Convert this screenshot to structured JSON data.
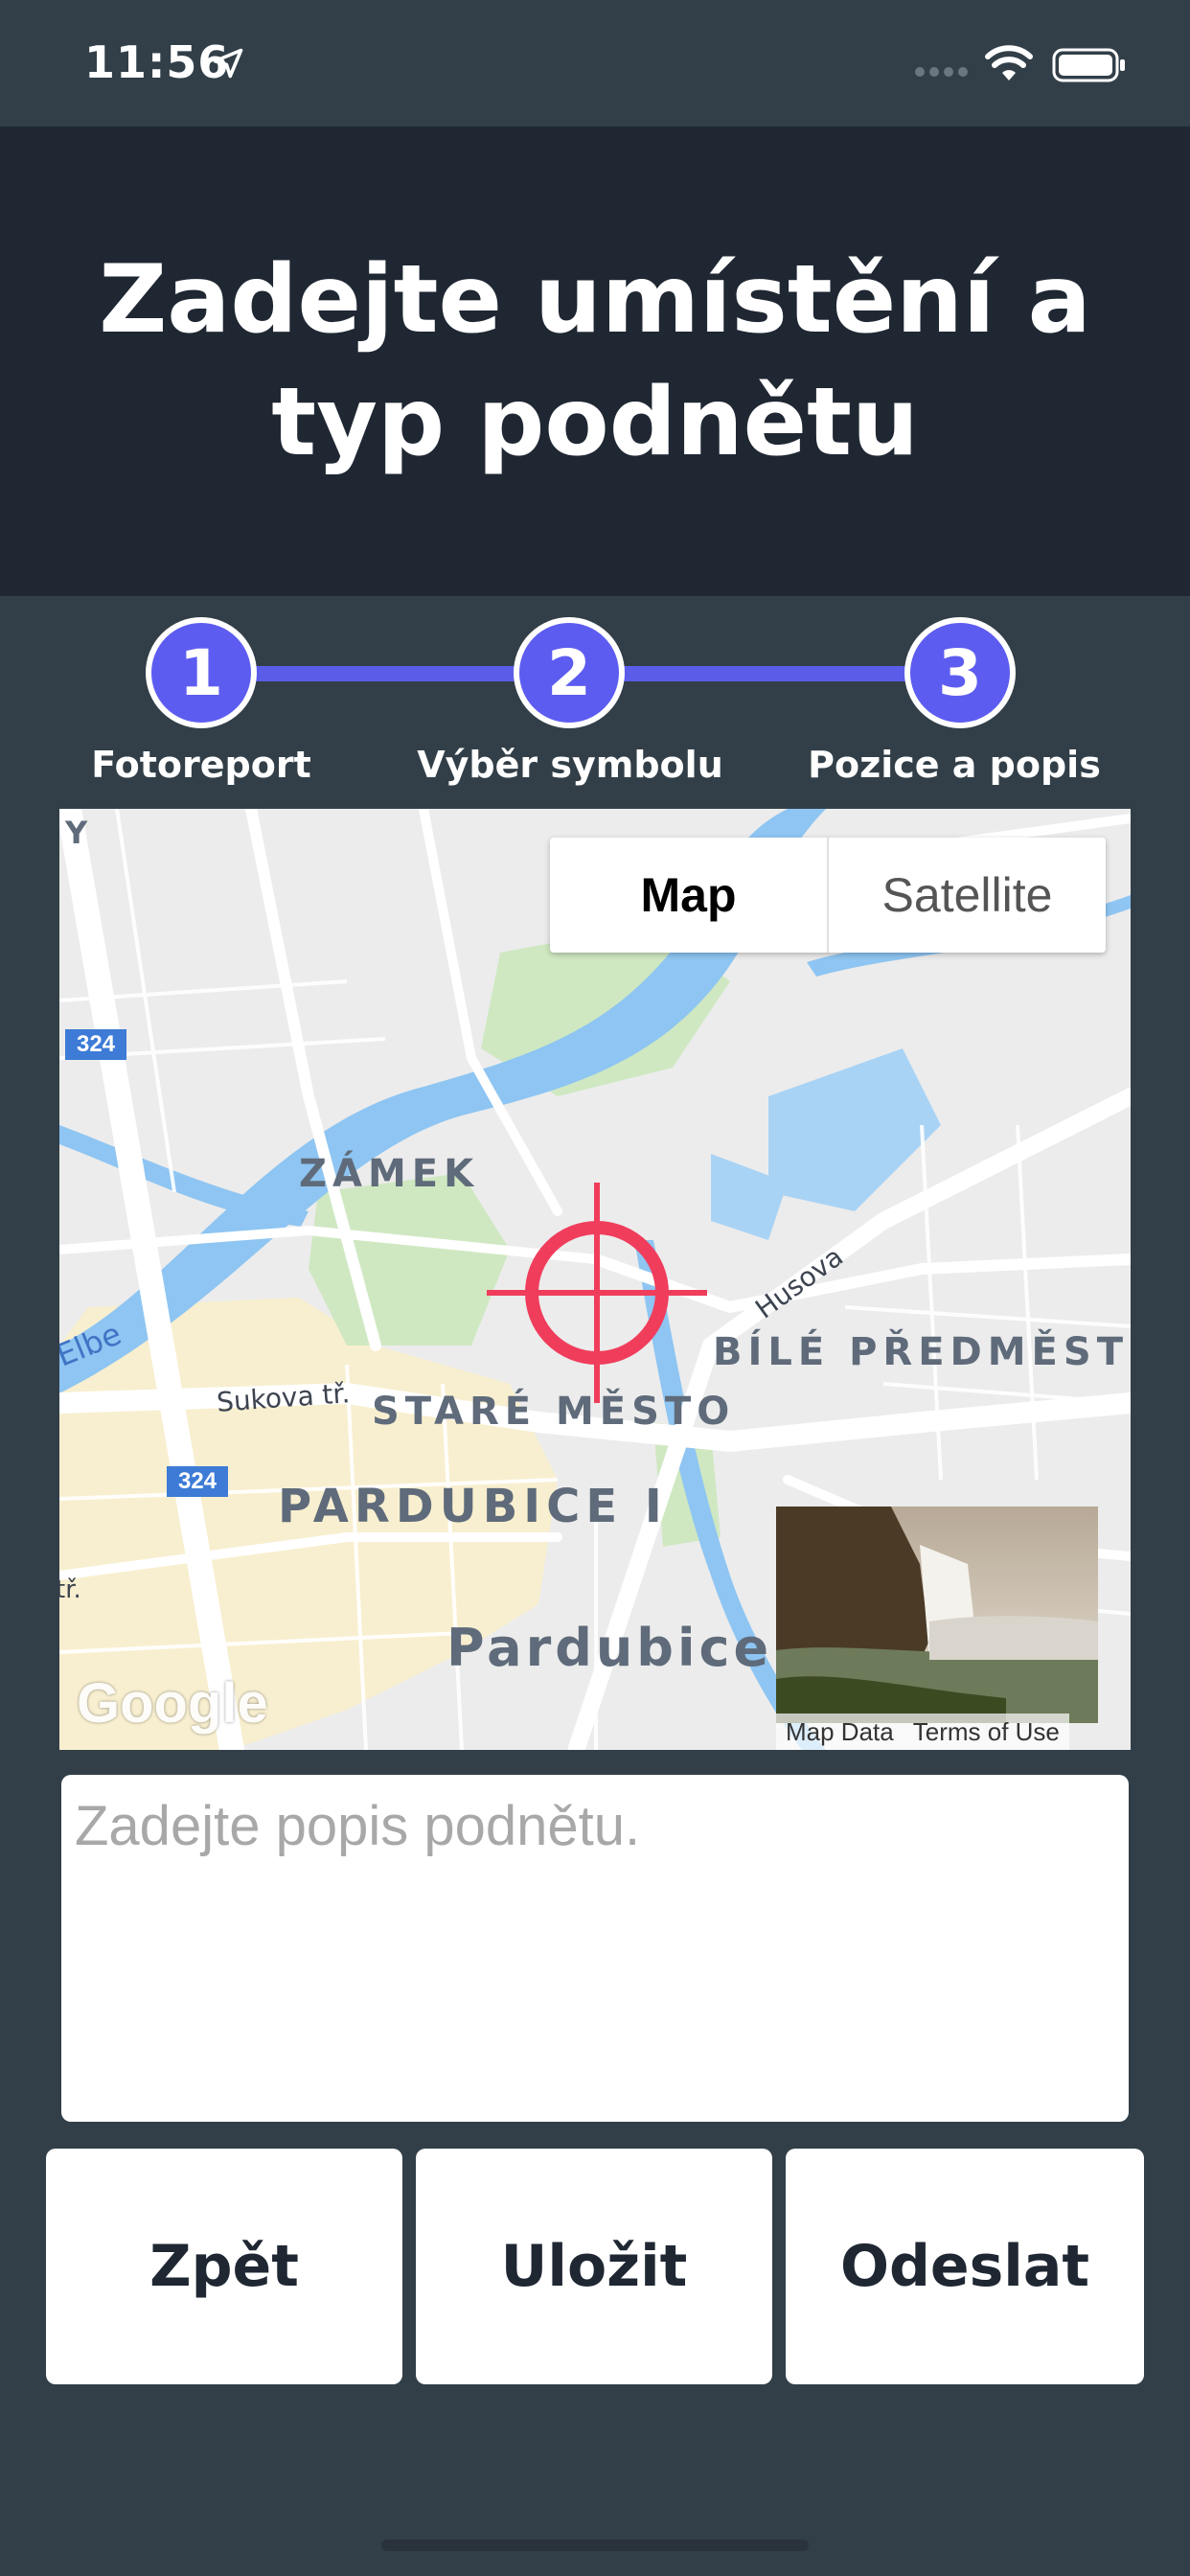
{
  "status_bar": {
    "time": "11:56"
  },
  "header": {
    "title": "Zadejte umístění a typ podnětu"
  },
  "stepper": {
    "steps": [
      {
        "number": "1",
        "label": "Fotoreport"
      },
      {
        "number": "2",
        "label": "Výběr symbolu"
      },
      {
        "number": "3",
        "label": "Pozice a popis"
      }
    ],
    "accent_color": "#5d5cf0"
  },
  "map": {
    "toggle": {
      "map_label": "Map",
      "satellite_label": "Satellite",
      "selected": "Map"
    },
    "labels": {
      "zamek": "ZÁMEK",
      "bile_predmesti": "BÍLÉ PŘEDMĚSTÍ",
      "stare_mesto": "STARÉ MĚSTO",
      "pardubice_i": "PARDUBICE I",
      "pardubice": "Pardubice",
      "sukova": "Sukova tř.",
      "husova": "Husova",
      "elbe": "Elbe",
      "tr": "tř.",
      "y": "Y"
    },
    "route_badges": [
      "324",
      "324"
    ],
    "google": "Google",
    "footer": {
      "map_data": "Map Data",
      "terms": "Terms of Use"
    }
  },
  "description": {
    "placeholder": "Zadejte popis podnětu.",
    "value": ""
  },
  "actions": {
    "back": "Zpět",
    "save": "Uložit",
    "send": "Odeslat"
  }
}
